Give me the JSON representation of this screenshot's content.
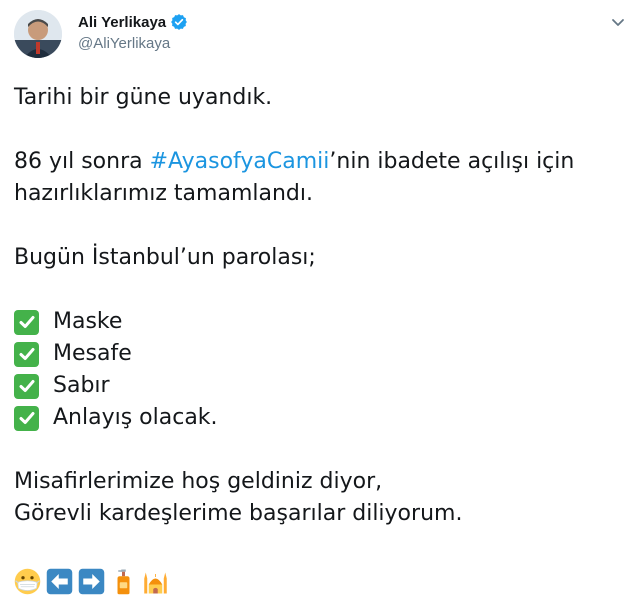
{
  "author": {
    "display_name": "Ali Yerlikaya",
    "handle": "@AliYerlikaya",
    "verified": true
  },
  "tweet": {
    "line1": "Tarihi bir güne uyandık.",
    "line2_pre": "86 yıl sonra ",
    "line2_hashtag": "#AyasofyaCamii",
    "line2_post": "’nin ibadete açılışı için",
    "line3": "hazırlıklarımız tamamlandı.",
    "line4": "Bugün İstanbul’un parolası;",
    "checklist": [
      "Maske",
      "Mesafe",
      "Sabır",
      "Anlayış olacak."
    ],
    "line5": "Misafirlerimize hoş geldiniz diyor,",
    "line6": "Görevli kardeşlerime başarılar diliyorum.",
    "emojis": [
      "face-with-medical-mask-icon",
      "left-arrow-icon",
      "right-arrow-icon",
      "hand-sanitizer-icon",
      "mosque-icon"
    ]
  },
  "colors": {
    "hashtag": "#1b95e0",
    "verified_badge": "#1da1f2",
    "check_green": "#44b24a",
    "arrow_blue": "#3b88c3"
  }
}
